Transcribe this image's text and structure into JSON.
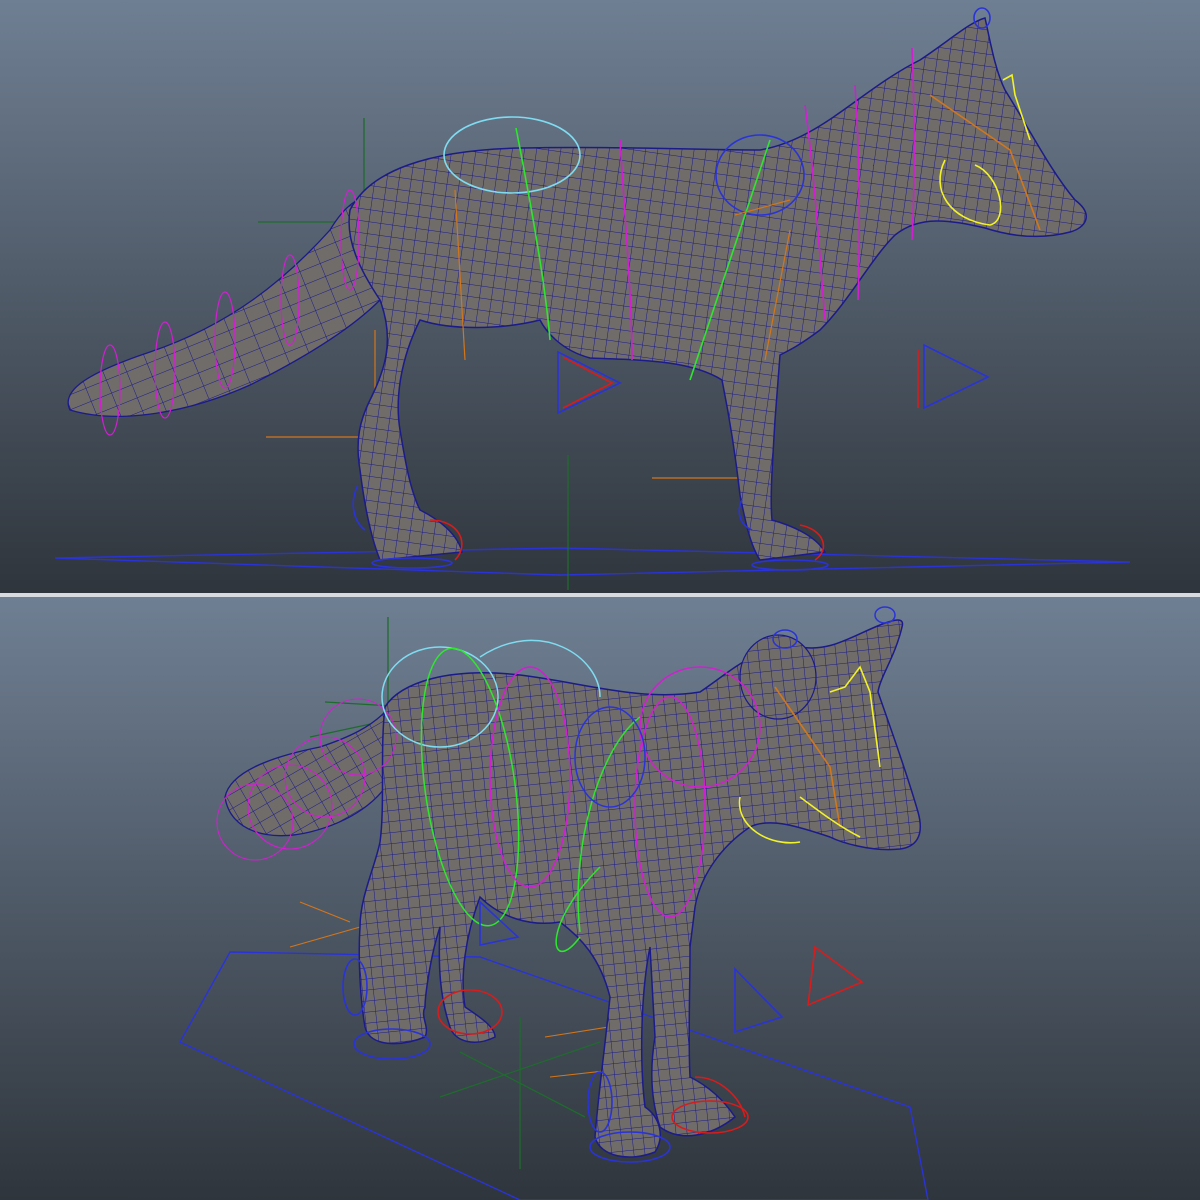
{
  "colors": {
    "bg_top": "#6f7f93",
    "bg_bottom": "#2f353c",
    "mesh_fill": "#706c6a",
    "wire": "#1b1b8a",
    "ctrl_blue": "#2a33d8",
    "ctrl_red": "#d81c1c",
    "ctrl_green": "#2ee62e",
    "ctrl_magenta": "#d21fd2",
    "ctrl_cyan": "#7fdcf0",
    "ctrl_yellow": "#f2f22a",
    "ctrl_orange": "#d2761c",
    "locator_green": "#1f6b2e"
  },
  "viewports": [
    {
      "id": "side",
      "view": "orthographic-side",
      "subject": "fox-rig"
    },
    {
      "id": "perspective",
      "view": "perspective",
      "subject": "fox-rig"
    }
  ],
  "icons": [
    "ik-triangle-icon",
    "foot-control-icon",
    "locator-cross-icon",
    "ground-plane-icon"
  ]
}
